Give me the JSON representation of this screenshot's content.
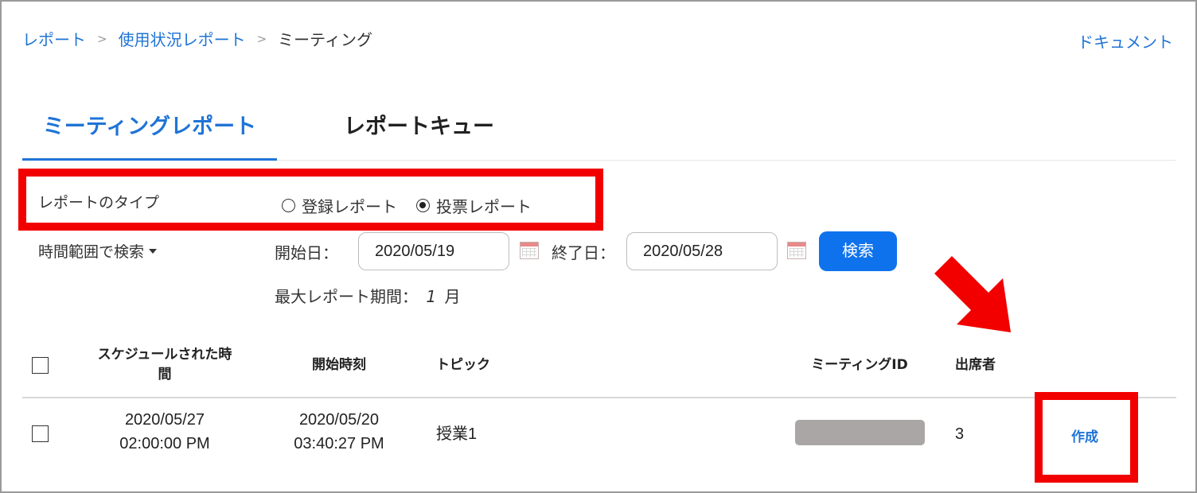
{
  "breadcrumb": {
    "items": [
      "レポート",
      "使用状況レポート",
      "ミーティング"
    ],
    "separator": ">"
  },
  "doc_link": "ドキュメント",
  "tabs": [
    {
      "label": "ミーティングレポート",
      "active": true
    },
    {
      "label": "レポートキュー",
      "active": false
    }
  ],
  "report_type": {
    "label": "レポートのタイプ",
    "options": [
      {
        "label": "登録レポート",
        "checked": false
      },
      {
        "label": "投票レポート",
        "checked": true
      }
    ]
  },
  "filter": {
    "range_dropdown": "時間範囲で検索",
    "start_label": "開始日：",
    "start_value": "2020/05/19",
    "end_label": "終了日：",
    "end_value": "2020/05/28",
    "search_button": "検索",
    "max_period_label": "最大レポート期間：",
    "max_period_value": "1",
    "max_period_unit": "月"
  },
  "table": {
    "headers": {
      "scheduled_line1": "スケジュールされた時",
      "scheduled_line2": "間",
      "start_time": "開始時刻",
      "topic": "トピック",
      "meeting_id": "ミーティングID",
      "attendees": "出席者"
    },
    "rows": [
      {
        "scheduled_date": "2020/05/27",
        "scheduled_time": "02:00:00 PM",
        "start_date": "2020/05/20",
        "start_time": "03:40:27 PM",
        "topic": "授業1",
        "attendees": "3",
        "action": "作成"
      }
    ]
  },
  "colors": {
    "accent": "#1f74d6",
    "button": "#0e72ed",
    "highlight": "#f20000"
  }
}
